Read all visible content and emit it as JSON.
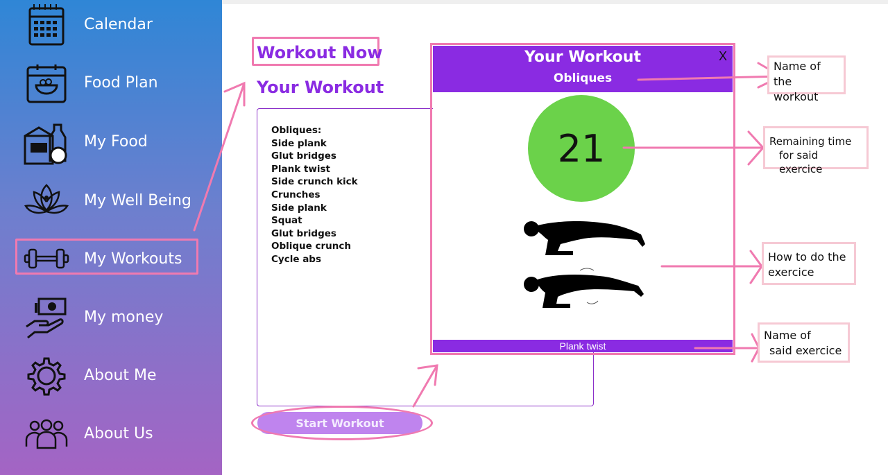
{
  "sidebar": {
    "items": [
      {
        "label": "Calendar",
        "icon": "calendar-icon"
      },
      {
        "label": "Food Plan",
        "icon": "food-plan-icon"
      },
      {
        "label": "My Food",
        "icon": "groceries-icon"
      },
      {
        "label": "My Well Being",
        "icon": "lotus-icon"
      },
      {
        "label": "My Workouts",
        "icon": "dumbbell-icon"
      },
      {
        "label": "My money",
        "icon": "money-hand-icon"
      },
      {
        "label": "About Me",
        "icon": "gear-icon"
      },
      {
        "label": "About Us",
        "icon": "people-group-icon"
      }
    ]
  },
  "main": {
    "title": "Workout Now",
    "subtitle": "Your Workout",
    "workout_list": [
      "Obliques:",
      "Side plank",
      "Glut bridges",
      "Plank twist",
      "Side crunch kick",
      "Crunches",
      "Side plank",
      "Squat",
      "Glut bridges",
      "Oblique crunch",
      "Cycle abs"
    ],
    "start_button": "Start Workout"
  },
  "modal": {
    "title": "Your Workout",
    "workout_name": "Obliques",
    "close_label": "X",
    "timer": "21",
    "exercise_name": "Plank twist",
    "illustration": "plank-twist-illustration"
  },
  "annotations": {
    "workout_name": [
      "Name of the",
      "workout"
    ],
    "remaining_time": [
      "Remaining time",
      "for said exercice"
    ],
    "how_to": [
      "How to do the",
      "exercice"
    ],
    "exercise_name": [
      "Name of",
      "said exercice"
    ]
  },
  "colors": {
    "accent": "#8a2be2",
    "highlight": "#f07ab0",
    "timer": "#6bd24a",
    "button": "#bf84ee"
  }
}
